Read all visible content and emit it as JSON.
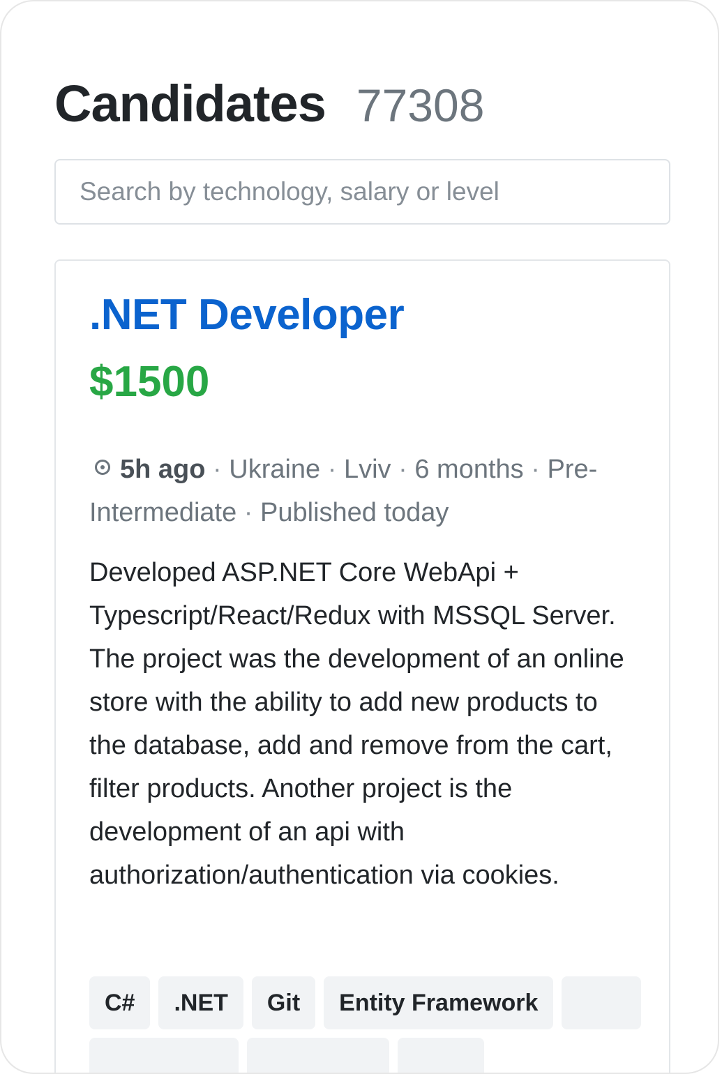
{
  "header": {
    "title": "Candidates",
    "count": "77308"
  },
  "search": {
    "placeholder": "Search by technology, salary or level",
    "value": ""
  },
  "candidate": {
    "title": ".NET Developer",
    "salary": "$1500",
    "meta": {
      "status_icon": "radio-dot-icon",
      "last_seen": "5h ago",
      "separator": "·",
      "country": "Ukraine",
      "city": "Lviv",
      "experience": "6 months",
      "english": "Pre-Intermediate",
      "published": "Published today"
    },
    "description": "Developed ASP.NET Core WebApi + Typescript/React/Redux with MSSQL Server. The project was the development of an online store with the ability to add new products to the database, add and remove from the cart, filter products. Another project is the development of an api with authorization/authentication via cookies.",
    "skills": [
      "C#",
      ".NET",
      "Git",
      "Entity Framework"
    ]
  },
  "colors": {
    "title_blue": "#0b63ce",
    "salary_green": "#28a745",
    "muted_gray": "#6c757d",
    "tag_bg": "#f1f3f5"
  }
}
